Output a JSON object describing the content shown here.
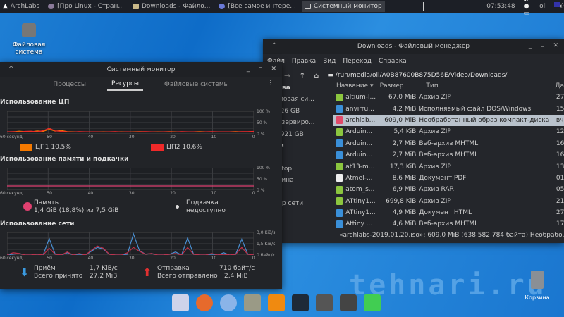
{
  "taskbar": {
    "launcher": "ArchLabs",
    "tasks": [
      "[Про Linux - Стран...",
      "Downloads - Файло...",
      "[Все самое интере...",
      "Системный монитор"
    ],
    "clock": "07:53:48",
    "user": "oll"
  },
  "desktop": {
    "filesystem_label": "Файловая система",
    "trash_label": "Корзина",
    "watermark": "tehnari.ru"
  },
  "file_manager": {
    "title": "Downloads - Файловый менеджер",
    "menu": [
      "Файл",
      "Правка",
      "Вид",
      "Переход",
      "Справка"
    ],
    "path": "/run/media/oll/A0B87600B875D56E/Video/Downloads/",
    "sidebar": [
      {
        "label": "ойства",
        "h": true
      },
      {
        "label": "Файловая си..."
      },
      {
        "label": "Том 26 GB"
      },
      {
        "label": "Зарезервиро..."
      },
      {
        "label": "Том 921 GB"
      },
      {
        "label": "адки",
        "h": true
      },
      {
        "label": "oll"
      },
      {
        "label": "Desktop"
      },
      {
        "label": "Корзина"
      },
      {
        "label": ""
      },
      {
        "label": "Обзор сети"
      }
    ],
    "columns": [
      "Название ▾",
      "Размер",
      "Тип",
      "Да"
    ],
    "rows": [
      {
        "name": "altium-l...",
        "size": "67,0 MiB",
        "type": "Архив ZIP",
        "date": "27",
        "color": "#8cc63f"
      },
      {
        "name": "anvirru...",
        "size": "4,2 MiB",
        "type": "Исполняемый файл DOS/Windows",
        "date": "15",
        "color": "#3a8fd8"
      },
      {
        "name": "archlab...",
        "size": "609,0 MiB",
        "type": "Необработанный образ компакт-диска",
        "date": "вч",
        "color": "#e24a6a",
        "selected": true
      },
      {
        "name": "Arduin...",
        "size": "5,4 KiB",
        "type": "Архив ZIP",
        "date": "12",
        "color": "#8cc63f"
      },
      {
        "name": "Arduin...",
        "size": "2,7 MiB",
        "type": "Веб-архив MHTML",
        "date": "16",
        "color": "#3a8fd8"
      },
      {
        "name": "Arduin...",
        "size": "2,7 MiB",
        "type": "Веб-архив MHTML",
        "date": "16",
        "color": "#3a8fd8"
      },
      {
        "name": "at13-m...",
        "size": "17,3 KiB",
        "type": "Архив ZIP",
        "date": "13",
        "color": "#8cc63f"
      },
      {
        "name": "Atmel-...",
        "size": "8,6 MiB",
        "type": "Документ PDF",
        "date": "01",
        "color": "#eeeeee"
      },
      {
        "name": "atom_s...",
        "size": "6,9 MiB",
        "type": "Архив RAR",
        "date": "05",
        "color": "#8cc63f"
      },
      {
        "name": "ATtiny1...",
        "size": "699,8 KiB",
        "type": "Архив ZIP",
        "date": "21",
        "color": "#8cc63f"
      },
      {
        "name": "ATtiny1...",
        "size": "4,9 MiB",
        "type": "Документ HTML",
        "date": "27",
        "color": "#3a8fd8"
      },
      {
        "name": "Attiny ...",
        "size": "4,6 MiB",
        "type": "Веб-архив MHTML",
        "date": "17",
        "color": "#3a8fd8"
      }
    ],
    "status": "«archlabs-2019.01.20.iso»: 609,0 MiB (638 582 784 байта) Необрабо..."
  },
  "system_monitor": {
    "title": "Системный монитор",
    "tabs": [
      "Процессы",
      "Ресурсы",
      "Файловые системы"
    ],
    "cpu": {
      "heading": "Использование ЦП",
      "y_ticks": [
        "100 %",
        "50 %",
        "0 %"
      ],
      "x_ticks": [
        "60 секунд",
        "50",
        "40",
        "30",
        "20",
        "10",
        "0"
      ],
      "cpu1": {
        "label": "ЦП1 10,5%",
        "color": "#f57900",
        "values": [
          8,
          9,
          12,
          10,
          9,
          13,
          11,
          20,
          12,
          15,
          10,
          9,
          9,
          8,
          9,
          8,
          9,
          8,
          9,
          9,
          8,
          9,
          10,
          9,
          8,
          9,
          9,
          10,
          9,
          8,
          9,
          9,
          10,
          9,
          9,
          8,
          9,
          9,
          10,
          9,
          9,
          10
        ]
      },
      "cpu2": {
        "label": "ЦП2 10,6%",
        "color": "#ef2929",
        "values": [
          9,
          10,
          8,
          11,
          12,
          9,
          14,
          25,
          13,
          11,
          9,
          8,
          10,
          9,
          9,
          9,
          8,
          9,
          10,
          8,
          9,
          8,
          9,
          10,
          9,
          8,
          9,
          9,
          8,
          10,
          9,
          9,
          8,
          9,
          10,
          9,
          9,
          9,
          8,
          10,
          10,
          11
        ]
      }
    },
    "memory": {
      "heading": "Использование памяти и подкачки",
      "y_ticks": [
        "100 %",
        "50 %",
        "0 %"
      ],
      "x_ticks": [
        "60 секунд",
        "50",
        "40",
        "30",
        "20",
        "10",
        "0"
      ],
      "memory_percent": 18.8,
      "swap_percent": 0,
      "memory_label": "Память",
      "memory_value": "1,4 GiB (18,8%) из 7,5 GiB",
      "swap_label": "Подкачка",
      "swap_value": "недоступно",
      "memory_color": "#e04070"
    },
    "network": {
      "heading": "Использование сети",
      "y_ticks": [
        "3,0 KiB/s",
        "1,5 KiB/s",
        "0 байт/с"
      ],
      "x_ticks": [
        "60 секунд",
        "50",
        "40",
        "30",
        "20",
        "10",
        "0"
      ],
      "recv_values": [
        0,
        0.1,
        0.2,
        0,
        0,
        0.1,
        0,
        2.2,
        0.1,
        0,
        0.3,
        0,
        0.1,
        0,
        0.5,
        1.0,
        0.8,
        0.1,
        0,
        0,
        0.1,
        2.8,
        0.6,
        0.1,
        0.2,
        0,
        0,
        0.1,
        0.4,
        0,
        2.3,
        0.1,
        0,
        0,
        0.1,
        0,
        0.3,
        0,
        0.1,
        2.1,
        0.1,
        0
      ],
      "sent_values": [
        0,
        0.3,
        0.2,
        0,
        0,
        0.1,
        0,
        0.9,
        0.1,
        0,
        0.4,
        0,
        0.2,
        0,
        0.6,
        1.2,
        0.9,
        0.1,
        0,
        0,
        0.3,
        1.0,
        0.5,
        0.1,
        0.2,
        0,
        0,
        0.1,
        0.2,
        0,
        1.0,
        0.1,
        0,
        0,
        0.2,
        0,
        0.1,
        0,
        0.1,
        1.0,
        0.1,
        0
      ],
      "recv_label": "Приём",
      "recv_rate": "1,7 KiB/с",
      "recv_total_label": "Всего принято",
      "recv_total": "27,2 MiB",
      "sent_label": "Отправка",
      "sent_rate": "710 байт/с",
      "sent_total_label": "Всего отправлено",
      "sent_total": "2,4 MiB"
    }
  },
  "dock": [
    "mail",
    "firefox",
    "chromium",
    "file-manager",
    "vlc",
    "system-monitor",
    "terminal",
    "sublime-text",
    "qt-creator"
  ]
}
